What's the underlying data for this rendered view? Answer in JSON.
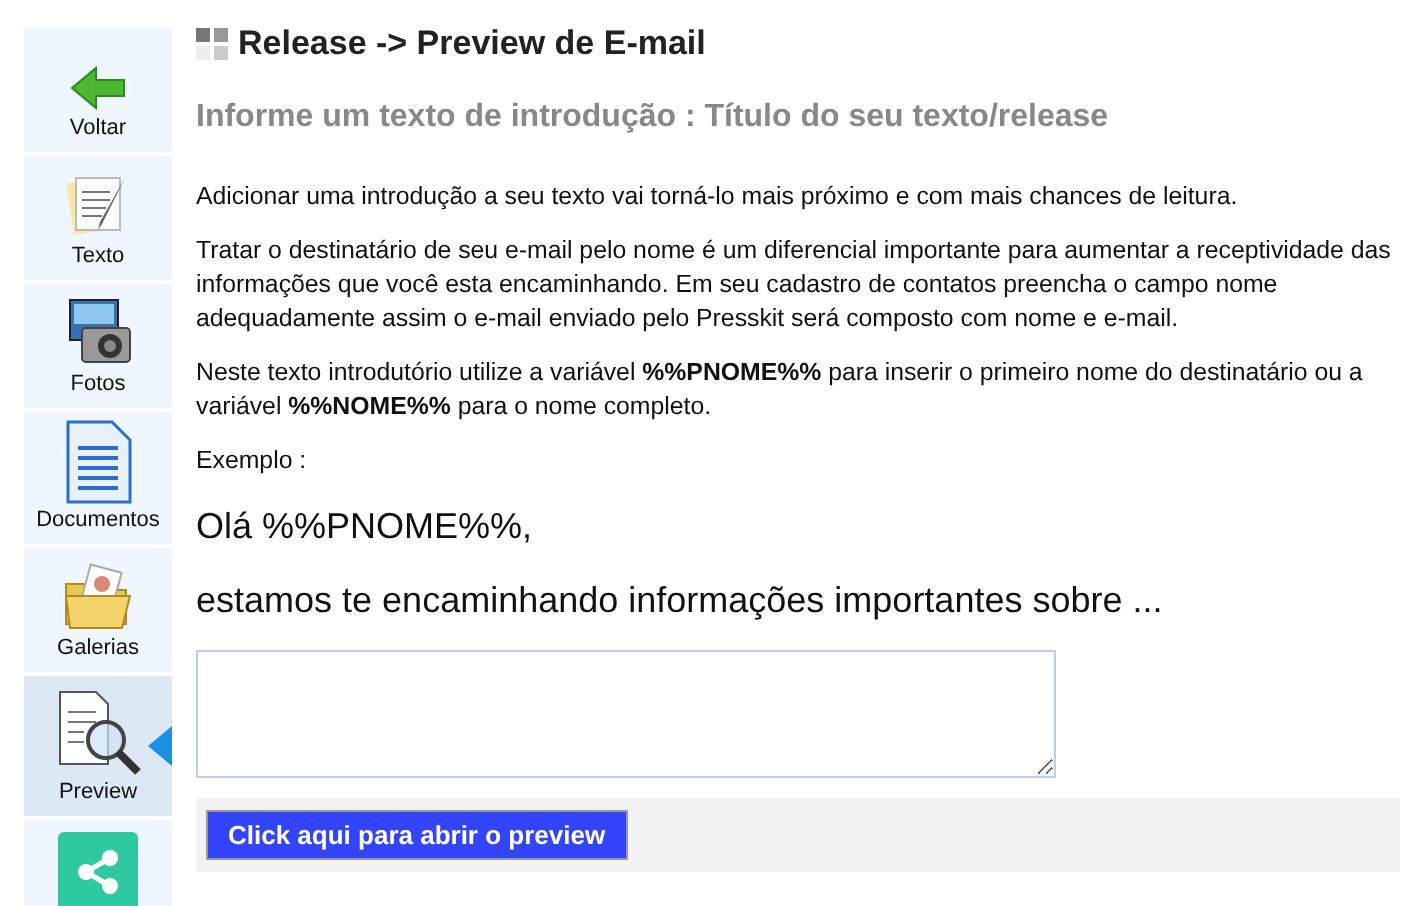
{
  "sidebar": {
    "items": [
      {
        "kind": "back",
        "label": "Voltar",
        "selected": false
      },
      {
        "kind": "text",
        "label": "Texto",
        "selected": false
      },
      {
        "kind": "photos",
        "label": "Fotos",
        "selected": false
      },
      {
        "kind": "documents",
        "label": "Documentos",
        "selected": false
      },
      {
        "kind": "galleries",
        "label": "Galerias",
        "selected": false
      },
      {
        "kind": "preview",
        "label": "Preview",
        "selected": true
      },
      {
        "kind": "share",
        "selected": false
      }
    ]
  },
  "title": "Release -> Preview de E-mail",
  "subtitle": "Informe um texto de introdução : Título do seu texto/release",
  "paragraphs": [
    "Adicionar uma introdução a seu texto vai torná-lo mais próximo e com mais chances de leitura.",
    "Tratar o destinatário de seu e-mail pelo nome é um diferencial importante para aumentar a receptividade das informações que você esta encaminhando. Em seu cadastro de contatos preencha o campo nome adequadamente assim o e-mail enviado pelo Presskit será composto com nome e e-mail.",
    "Neste texto introdutório utilize a variável **%%PNOME%%** para inserir o primeiro nome do destinatário ou a variável **%%NOME%%** para o nome completo."
  ],
  "example_label": "Exemplo :",
  "example_lines": [
    "Olá %%PNOME%%,",
    "estamos te encaminhando informações importantes sobre ..."
  ],
  "button": "Click aqui para abrir o preview"
}
